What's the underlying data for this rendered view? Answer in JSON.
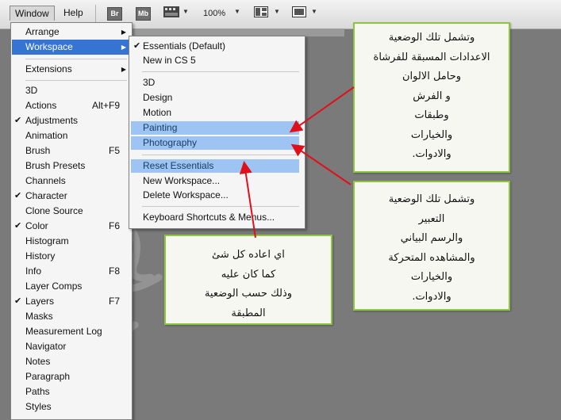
{
  "toolbar": {
    "window_label": "Window",
    "help_label": "Help",
    "br_label": "Br",
    "mb_label": "Mb",
    "zoom": "100%",
    "icons": [
      "film-icon",
      "layout-icon",
      "screen-mode-icon"
    ]
  },
  "window_menu": {
    "items": [
      {
        "label": "Arrange",
        "submenu": true
      },
      {
        "label": "Workspace",
        "submenu": true,
        "highlighted": true
      },
      {
        "label": "Extensions",
        "submenu": true
      },
      {
        "label": "3D"
      },
      {
        "label": "Actions",
        "shortcut": "Alt+F9"
      },
      {
        "label": "Adjustments",
        "checked": true
      },
      {
        "label": "Animation"
      },
      {
        "label": "Brush",
        "shortcut": "F5"
      },
      {
        "label": "Brush Presets"
      },
      {
        "label": "Channels"
      },
      {
        "label": "Character",
        "checked": true
      },
      {
        "label": "Clone Source"
      },
      {
        "label": "Color",
        "shortcut": "F6",
        "checked": true
      },
      {
        "label": "Histogram"
      },
      {
        "label": "History"
      },
      {
        "label": "Info",
        "shortcut": "F8"
      },
      {
        "label": "Layer Comps"
      },
      {
        "label": "Layers",
        "shortcut": "F7",
        "checked": true
      },
      {
        "label": "Masks"
      },
      {
        "label": "Measurement Log"
      },
      {
        "label": "Navigator"
      },
      {
        "label": "Notes"
      },
      {
        "label": "Paragraph"
      },
      {
        "label": "Paths"
      },
      {
        "label": "Styles"
      }
    ]
  },
  "workspace_menu": {
    "items": [
      {
        "label": "Essentials (Default)",
        "checked": true
      },
      {
        "label": "New in CS 5"
      },
      {
        "label": "3D"
      },
      {
        "label": "Design"
      },
      {
        "label": "Motion"
      },
      {
        "label": "Painting",
        "highlighted": true
      },
      {
        "label": "Photography",
        "highlighted": true
      },
      {
        "label": "Reset Essentials",
        "highlighted": true
      },
      {
        "label": "New Workspace..."
      },
      {
        "label": "Delete Workspace..."
      },
      {
        "label": "Keyboard Shortcuts & Menus..."
      }
    ]
  },
  "notes": {
    "painting": [
      "وتشمل تلك الوضعية",
      "الاعدادات المسبقة للفرشاة",
      "وحامل الالوان",
      "و الفرش",
      "وطبقات",
      "والخيارات",
      "والادوات."
    ],
    "photography": [
      "وتشمل تلك الوضعية",
      "التعبير",
      "والرسم البياني",
      "والمشاهده المتحركة",
      "والخيارات",
      "والادوات."
    ],
    "reset": [
      "اي اعاده كل شئ",
      "كما كان عليه",
      "وذلك حسب الوضعية",
      "المطبقة"
    ]
  },
  "colors": {
    "menu_highlight": "#3574d2",
    "submenu_highlight": "#9dc4f2",
    "note_border": "#8cc63f",
    "arrow": "#e0101a"
  }
}
